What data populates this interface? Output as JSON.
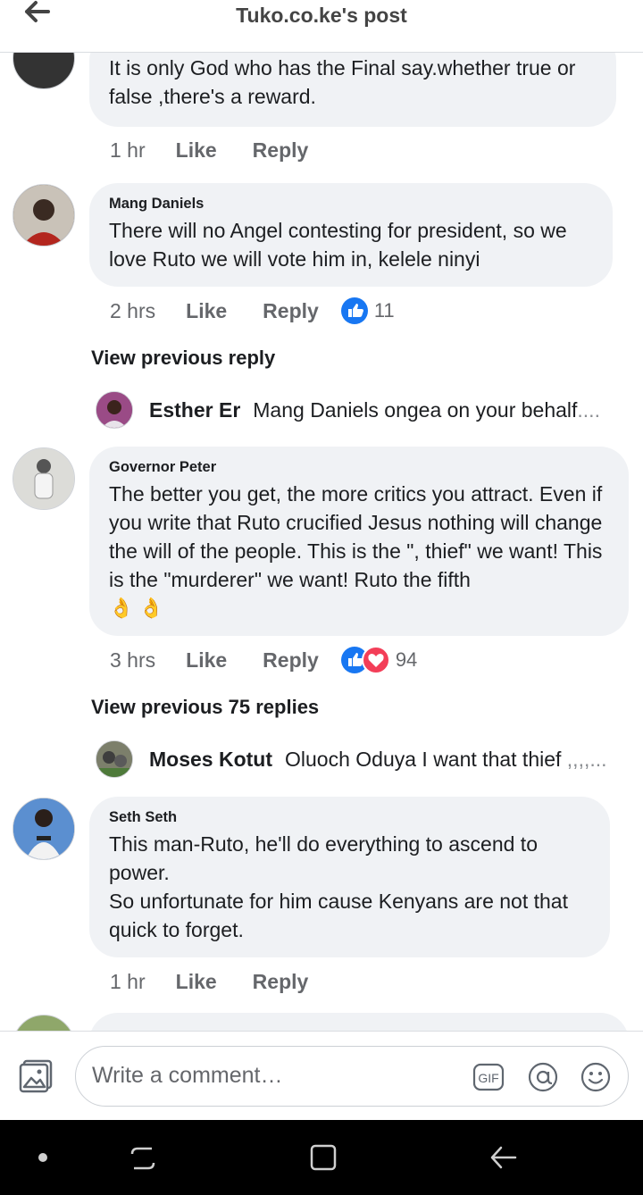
{
  "header": {
    "title": "Tuko.co.ke's post"
  },
  "comments": [
    {
      "author": "",
      "text": "It is only God who has the Final say.whether true or false ,there's a reward.",
      "time": "1 hr",
      "like": "Like",
      "reply": "Reply",
      "reactions": null
    },
    {
      "author": "Mang Daniels",
      "text": "There will no Angel contesting for president, so we love Ruto we will vote him in, kelele ninyi",
      "time": "2 hrs",
      "like": "Like",
      "reply": "Reply",
      "reactions": "11"
    },
    {
      "author": "Governor Peter",
      "text": "The better you get, the more critics you attract. Even if you write that Ruto crucified Jesus nothing will change the will of the people. This is the \", thief\" we want! This is the \"murderer\" we want! Ruto the fifth",
      "emoji": "👌 👌",
      "time": "3 hrs",
      "like": "Like",
      "reply": "Reply",
      "reactions": "94"
    },
    {
      "author": "Seth Seth",
      "text": "This man-Ruto, he'll do everything to ascend to power.\nSo unfortunate for him cause Kenyans are not that quick to forget.",
      "time": "1 hr",
      "like": "Like",
      "reply": "Reply",
      "reactions": null
    }
  ],
  "threads": [
    {
      "view_previous": "View previous reply",
      "reply_name": "Esther Er",
      "reply_text": "Mang Daniels ongea on your behalf",
      "reply_fade": "...."
    },
    {
      "view_previous": "View previous 75 replies",
      "reply_name": "Moses Kotut",
      "reply_text": "Oluoch Oduya I want that thief ",
      "reply_fade": ",,,,..."
    }
  ],
  "composer": {
    "placeholder": "Write a comment…",
    "gif_label": "GIF"
  },
  "colors": {
    "like_blue": "#1877f2",
    "love_red": "#f33e58",
    "bubble_bg": "#f0f2f5",
    "meta_gray": "#65676b"
  },
  "icons": [
    "back-arrow-icon",
    "photo-icon",
    "gif-icon",
    "mention-icon",
    "emoji-icon",
    "like-icon",
    "love-icon"
  ]
}
